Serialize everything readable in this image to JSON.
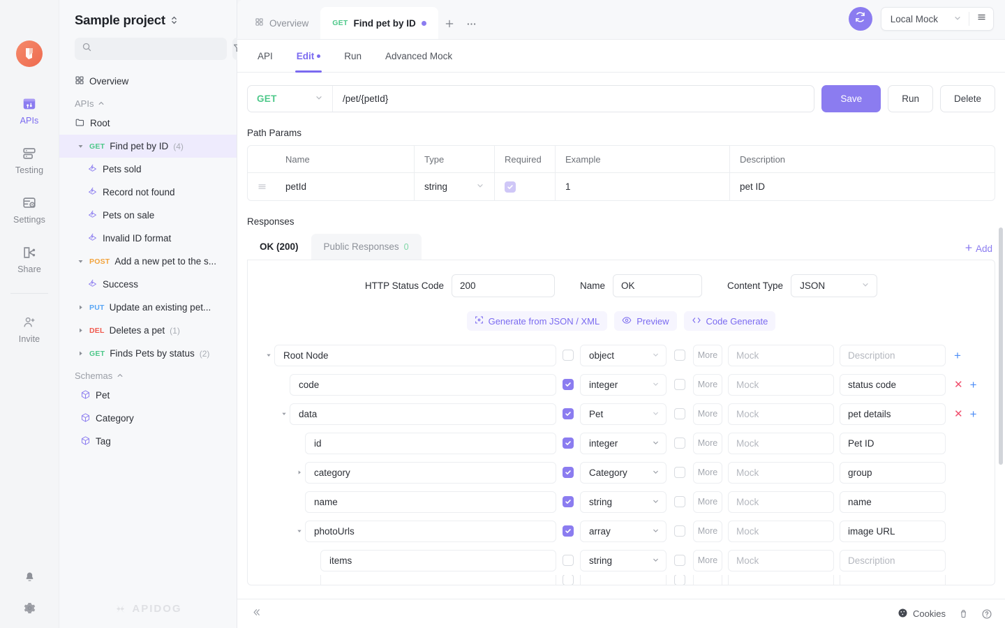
{
  "rail": {
    "logo_icon": "apidog-logo-icon",
    "items": [
      {
        "label": "APIs",
        "icon": "apis-icon",
        "active": true
      },
      {
        "label": "Testing",
        "icon": "testing-icon",
        "active": false
      },
      {
        "label": "Settings",
        "icon": "settings-icon",
        "active": false
      },
      {
        "label": "Share",
        "icon": "share-icon",
        "active": false
      },
      {
        "label": "Invite",
        "icon": "invite-icon",
        "active": false
      }
    ],
    "bottom": [
      {
        "icon": "bell-icon"
      },
      {
        "icon": "gear-icon"
      }
    ]
  },
  "sidebar": {
    "project_name": "Sample project",
    "search_placeholder": "",
    "filter_icon": "filter-icon",
    "add_icon": "plus-icon",
    "overview_label": "Overview",
    "group_apis": "APIs",
    "group_schemas": "Schemas",
    "root_label": "Root",
    "watermark": "APIDOG",
    "items": [
      {
        "method": "GET",
        "label": "Find pet by ID",
        "count": "(4)",
        "selected": true,
        "expanded": true
      },
      {
        "label": "Pets sold",
        "kind": "response"
      },
      {
        "label": "Record not found",
        "kind": "response"
      },
      {
        "label": "Pets on sale",
        "kind": "response"
      },
      {
        "label": "Invalid ID format",
        "kind": "response"
      },
      {
        "method": "POST",
        "label": "Add a new pet to the s...",
        "count": "",
        "expanded": true
      },
      {
        "label": "Success",
        "kind": "response"
      },
      {
        "method": "PUT",
        "label": "Update an existing pet...",
        "count": ""
      },
      {
        "method": "DEL",
        "label": "Deletes a pet",
        "count": "(1)"
      },
      {
        "method": "GET",
        "label": "Finds Pets by status",
        "count": "(2)"
      }
    ],
    "schemas": [
      {
        "label": "Pet"
      },
      {
        "label": "Category"
      },
      {
        "label": "Tag"
      }
    ]
  },
  "tabbar": {
    "tabs": [
      {
        "label": "Overview",
        "icon": "grid-icon",
        "active": false
      },
      {
        "method": "GET",
        "label": "Find pet by ID",
        "active": true,
        "dirty": true
      }
    ],
    "new_tab_icon": "plus-icon",
    "more_icon": "ellipsis-icon",
    "sync_icon": "sync-icon",
    "environment": "Local Mock",
    "env_caret_icon": "chevron-down-icon",
    "menu_icon": "hamburger-icon"
  },
  "subtabs": [
    {
      "label": "API",
      "active": false
    },
    {
      "label": "Edit",
      "active": true,
      "dirty": true
    },
    {
      "label": "Run",
      "active": false
    },
    {
      "label": "Advanced Mock",
      "active": false
    }
  ],
  "request": {
    "method": "GET",
    "url": "/pet/{petId}",
    "save_label": "Save",
    "run_label": "Run",
    "delete_label": "Delete"
  },
  "path_params": {
    "title": "Path Params",
    "columns": [
      "Name",
      "Type",
      "Required",
      "Example",
      "Description"
    ],
    "rows": [
      {
        "name": "petId",
        "type": "string",
        "required": true,
        "example": "1",
        "description": "pet ID"
      }
    ]
  },
  "responses": {
    "title": "Responses",
    "tabs": [
      {
        "label": "OK (200)",
        "active": true
      },
      {
        "label": "Public Responses",
        "count": "0",
        "active": false
      }
    ],
    "add_label": "Add",
    "status_code_label": "HTTP Status Code",
    "status_code_value": "200",
    "name_label": "Name",
    "name_value": "OK",
    "content_type_label": "Content Type",
    "content_type_value": "JSON",
    "actions": [
      {
        "label": "Generate from JSON / XML",
        "icon": "generate-icon"
      },
      {
        "label": "Preview",
        "icon": "eye-icon"
      },
      {
        "label": "Code Generate",
        "icon": "code-icon"
      }
    ]
  },
  "schema_tree": {
    "mock_placeholder": "Mock",
    "description_placeholder": "Description",
    "more_label": "More",
    "rows": [
      {
        "name": "Root Node",
        "indent": 0,
        "caret": "down",
        "required": false,
        "type": "object",
        "mock": "",
        "description": "",
        "actions": [
          "add"
        ]
      },
      {
        "name": "code",
        "indent": 1,
        "caret": "",
        "required": true,
        "type": "integer",
        "mock": "",
        "description": "status code",
        "actions": [
          "remove",
          "add"
        ]
      },
      {
        "name": "data",
        "indent": 1,
        "caret": "down",
        "required": true,
        "type": "Pet",
        "mock": "",
        "description": "pet details",
        "actions": [
          "remove",
          "add"
        ]
      },
      {
        "name": "id",
        "indent": 2,
        "caret": "",
        "required": true,
        "type": "integer",
        "mock": "",
        "description": "Pet ID",
        "actions": []
      },
      {
        "name": "category",
        "indent": 2,
        "caret": "right",
        "required": true,
        "type": "Category",
        "mock": "",
        "description": "group",
        "actions": []
      },
      {
        "name": "name",
        "indent": 2,
        "caret": "",
        "required": true,
        "type": "string",
        "mock": "",
        "description": "name",
        "actions": []
      },
      {
        "name": "photoUrls",
        "indent": 2,
        "caret": "down",
        "required": true,
        "type": "array",
        "mock": "",
        "description": "image URL",
        "actions": []
      },
      {
        "name": "items",
        "indent": 3,
        "caret": "",
        "required": false,
        "type": "string",
        "mock": "",
        "description": "",
        "actions": []
      }
    ]
  },
  "footer": {
    "collapse_icon": "collapse-icon",
    "cookies_label": "Cookies",
    "cookies_icon": "cookie-icon",
    "trash_icon": "trash-icon",
    "help_icon": "help-icon"
  },
  "colors": {
    "accent": "#8b7cf0",
    "get": "#4ec88a",
    "post": "#f2a33c",
    "put": "#58a6f5",
    "del": "#f05a4f",
    "remove": "#f0506e",
    "add": "#4d8df6"
  }
}
